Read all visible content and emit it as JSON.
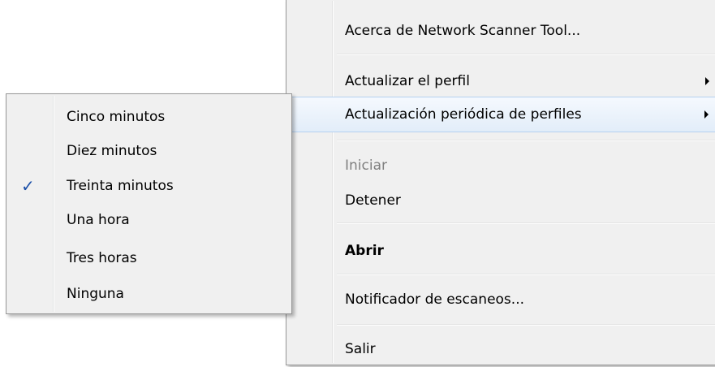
{
  "main_menu": {
    "items": [
      {
        "label": "Acerca de Network Scanner Tool..."
      },
      {
        "label": "Actualizar el perfil"
      },
      {
        "label": "Actualización periódica de perfiles"
      },
      {
        "label": "Iniciar"
      },
      {
        "label": "Detener"
      },
      {
        "label": "Abrir"
      },
      {
        "label": "Notificador de escaneos..."
      },
      {
        "label": "Salir"
      }
    ]
  },
  "submenu": {
    "items": [
      {
        "label": "Cinco minutos",
        "checked": false
      },
      {
        "label": "Diez minutos",
        "checked": false
      },
      {
        "label": "Treinta minutos",
        "checked": true
      },
      {
        "label": "Una hora",
        "checked": false
      },
      {
        "label": "Tres horas",
        "checked": false
      },
      {
        "label": "Ninguna",
        "checked": false
      }
    ],
    "check_glyph": "✓"
  },
  "colors": {
    "menu_background": "#f0f0f0",
    "menu_border": "#979797",
    "hover_border": "#b5d1f0",
    "check_color": "#1b4fa8",
    "disabled_text": "#7f7f7f"
  }
}
